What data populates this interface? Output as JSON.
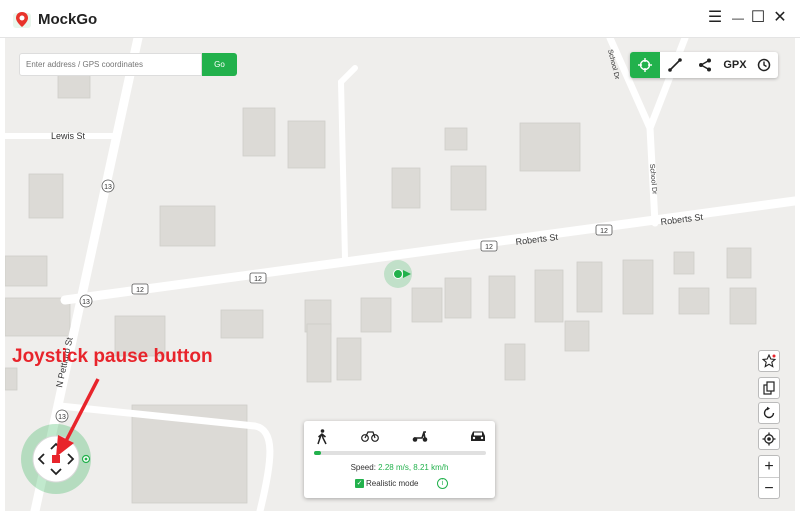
{
  "app": {
    "title": "MockGo"
  },
  "window_controls": {
    "menu": "☰",
    "minimize": "—",
    "maximize": "☐",
    "close": "✕"
  },
  "search": {
    "placeholder": "Enter address / GPS coordinates",
    "go_label": "Go"
  },
  "toolbar": {
    "gpx_label": "GPX"
  },
  "map_labels": {
    "lewis_st": "Lewis St",
    "roberts_st_1": "Roberts St",
    "roberts_st_2": "Roberts St",
    "school_dr_1": "School Dr",
    "school_dr_2": "School Dr",
    "n_pettigro_st": "N Pettigro St",
    "route_12_a": "12",
    "route_12_b": "12",
    "route_12_c": "12",
    "route_12_d": "12",
    "route_13_a": "13",
    "route_13_b": "13",
    "route_13_c": "13"
  },
  "speed_panel": {
    "speed_label": "Speed:",
    "speed_value": "2.28 m/s, 8.21 km/h",
    "speed_fraction": 0.04,
    "realistic_label": "Realistic mode",
    "realistic_checked": true
  },
  "annotation": {
    "text": "Joystick pause button",
    "color": "#e8242b"
  },
  "colors": {
    "accent": "#22b14c",
    "map_bg": "#efeeec",
    "road": "#ffffff",
    "building": "#dcdad6"
  },
  "icons": [
    "logo-pin-icon",
    "menu-icon",
    "minimize-icon",
    "maximize-icon",
    "close-icon",
    "crosshair-icon",
    "route-icon",
    "share-icon",
    "clock-icon",
    "favorite-star-icon",
    "copy-icon",
    "refresh-icon",
    "locate-icon",
    "zoom-in-icon",
    "zoom-out-icon",
    "walk-icon",
    "bicycle-icon",
    "scooter-icon",
    "car-icon",
    "pause-icon",
    "arrow-up-icon",
    "arrow-down-icon",
    "arrow-left-icon",
    "arrow-right-icon",
    "info-icon",
    "check-icon"
  ]
}
